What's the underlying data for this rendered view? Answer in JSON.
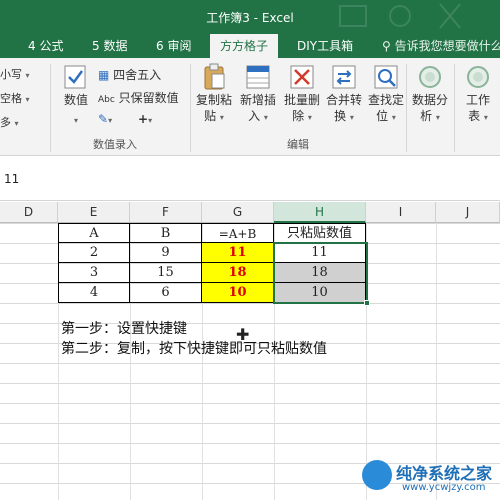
{
  "window": {
    "title": "工作簿3 - Excel"
  },
  "tabs": [
    {
      "label": "4 公式"
    },
    {
      "label": "5 数据"
    },
    {
      "label": "6 审阅"
    },
    {
      "label": "方方格子",
      "active": true
    },
    {
      "label": "DIY工具箱"
    }
  ],
  "tell_me": {
    "text": "告诉我您想要做什么"
  },
  "ribbon": {
    "left_partial": {
      "row1": "小写",
      "row2": "空格",
      "row3": "多"
    },
    "data_entry": {
      "numeric_btn": {
        "l1": "数值"
      },
      "round_label": "四舍五入",
      "keep_value_label": "只保留数值",
      "group_label": "数值录入"
    },
    "edit": {
      "copy_paste": {
        "l1": "复制粘",
        "l2": "贴"
      },
      "insert": {
        "l1": "新增插",
        "l2": "入"
      },
      "delete": {
        "l1": "批量删",
        "l2": "除"
      },
      "merge": {
        "l1": "合并转",
        "l2": "换"
      },
      "find": {
        "l1": "查找定",
        "l2": "位"
      },
      "group_label": "编辑"
    },
    "analysis": {
      "l1": "数据分",
      "l2": "析"
    },
    "work_table": {
      "l1": "工作",
      "l2": "表"
    }
  },
  "formula_bar": {
    "value": "11"
  },
  "columns": [
    "D",
    "E",
    "F",
    "G",
    "H",
    "I",
    "J"
  ],
  "selected_column": "H",
  "table": {
    "headers": [
      "A",
      "B",
      "=A+B",
      "只粘贴数值"
    ],
    "rows": [
      [
        "2",
        "9",
        "11",
        "11"
      ],
      [
        "3",
        "15",
        "18",
        "18"
      ],
      [
        "4",
        "6",
        "10",
        "10"
      ]
    ]
  },
  "notes": {
    "step1": "第一步：设置快捷键",
    "step2": "第二步：复制，按下快捷键即可只粘贴数值"
  },
  "watermark": {
    "name": "纯净系统之家",
    "url": "www.ycwjzy.com"
  },
  "colors": {
    "excel_green": "#217346",
    "highlight_yellow": "#ffff00",
    "result_red": "#e00000",
    "paste_gray": "#d0d0d0"
  }
}
